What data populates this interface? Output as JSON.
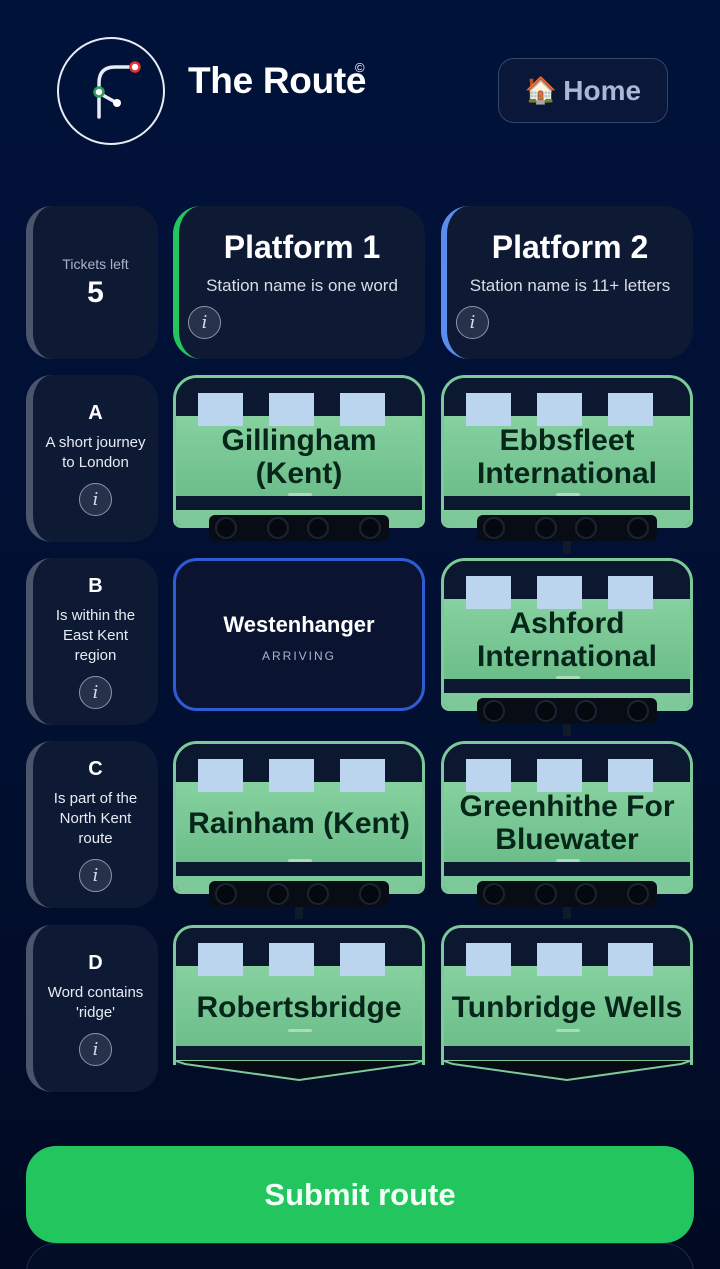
{
  "header": {
    "title": "The Route",
    "copyright": "©",
    "home_icon": "house-emoji",
    "home_emoji": "🏠",
    "home_label": "Home"
  },
  "tickets": {
    "label": "Tickets left",
    "count": "5"
  },
  "platforms": [
    {
      "title": "Platform 1",
      "rule": "Station name is one word",
      "accent": "#22c55e"
    },
    {
      "title": "Platform 2",
      "rule": "Station name is 11+ letters",
      "accent": "#5b8def"
    }
  ],
  "rules": [
    {
      "letter": "A",
      "text": "A short journey to London"
    },
    {
      "letter": "B",
      "text": "Is within the East Kent region"
    },
    {
      "letter": "C",
      "text": "Is part of the North Kent route"
    },
    {
      "letter": "D",
      "text": "Word contains 'ridge'"
    }
  ],
  "grid": {
    "a1": "Gillingham (Kent)",
    "a2": "Ebbsfleet International",
    "b1": "Westenhanger",
    "b1_status": "ARRIVING",
    "b2": "Ashford International",
    "c1": "Rainham (Kent)",
    "c2": "Greenhithe For Bluewater",
    "d1": "Robertsbridge",
    "d2": "Tunbridge Wells"
  },
  "info_glyph": "i",
  "submit_label": "Submit route",
  "colors": {
    "background": "#01123a",
    "card": "#0e1a33",
    "train_green": "#7ec99a",
    "submit_green": "#22c55e",
    "arriving_border": "#2f5bd3"
  }
}
